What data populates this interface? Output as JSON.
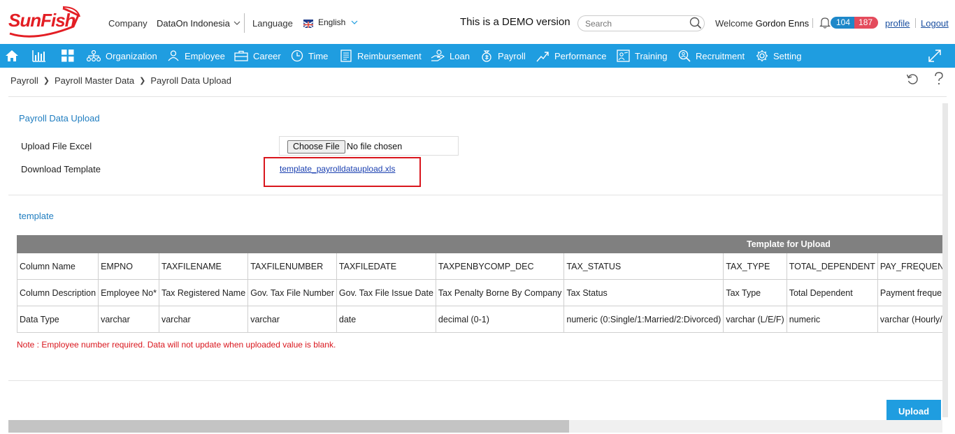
{
  "header": {
    "logo_text": "SunFish",
    "company_label": "Company",
    "company_value": "DataOn Indonesia",
    "language_label": "Language",
    "language_value": "English",
    "demo_text": "This is a DEMO version",
    "search_placeholder": "Search",
    "welcome_prefix": "Welcome",
    "user_name": "Gordon Enns",
    "badge_count_blue": "104",
    "badge_count_red": "187",
    "profile_link": "profile",
    "logout_link": "Logout"
  },
  "nav": {
    "items": [
      {
        "label": "Organization",
        "icon": "org-icon"
      },
      {
        "label": "Employee",
        "icon": "employee-icon"
      },
      {
        "label": "Career",
        "icon": "career-icon"
      },
      {
        "label": "Time",
        "icon": "clock-icon"
      },
      {
        "label": "Reimbursement",
        "icon": "receipt-icon"
      },
      {
        "label": "Loan",
        "icon": "loan-icon"
      },
      {
        "label": "Payroll",
        "icon": "payroll-icon"
      },
      {
        "label": "Performance",
        "icon": "trend-icon"
      },
      {
        "label": "Training",
        "icon": "training-icon"
      },
      {
        "label": "Recruitment",
        "icon": "recruit-icon"
      },
      {
        "label": "Setting",
        "icon": "gear-icon"
      }
    ]
  },
  "breadcrumb": [
    "Payroll",
    "Payroll Master Data",
    "Payroll Data Upload"
  ],
  "form": {
    "title": "Payroll Data Upload",
    "upload_label": "Upload File Excel",
    "choose_file_label": "Choose File",
    "file_status": "No file chosen",
    "download_label": "Download Template",
    "template_link": "template_payrolldataupload.xls"
  },
  "template": {
    "title": "template",
    "table_header": "Template for Upload",
    "rows": [
      [
        "Column Name",
        "EMPNO",
        "TAXFILENAME",
        "TAXFILENUMBER",
        "TAXFILEDATE",
        "TAXPENBYCOMP_DEC",
        "TAX_STATUS",
        "TAX_TYPE",
        "TOTAL_DEPENDENT",
        "PAY_FREQUENCY"
      ],
      [
        "Column Description",
        "Employee No*",
        "Tax Registered Name",
        "Gov. Tax File Number",
        "Gov. Tax File Issue Date",
        "Tax Penalty Borne By Company",
        "Tax Status",
        "Tax Type",
        "Total Dependent",
        "Payment frequency"
      ],
      [
        "Data Type",
        "varchar",
        "varchar",
        "varchar",
        "date",
        "decimal (0-1)",
        "numeric (0:Single/1:Married/2:Divorced)",
        "varchar (L/E/F)",
        "numeric",
        "varchar (Hourly/Daily)"
      ]
    ],
    "note": "Note : Employee number required. Data will not update when uploaded value is blank."
  },
  "actions": {
    "upload_label": "Upload"
  },
  "colors": {
    "nav_bg": "#1f9de0",
    "title_blue": "#1f7dc0",
    "note_red": "#d9161d",
    "table_header_bg": "#808080"
  }
}
